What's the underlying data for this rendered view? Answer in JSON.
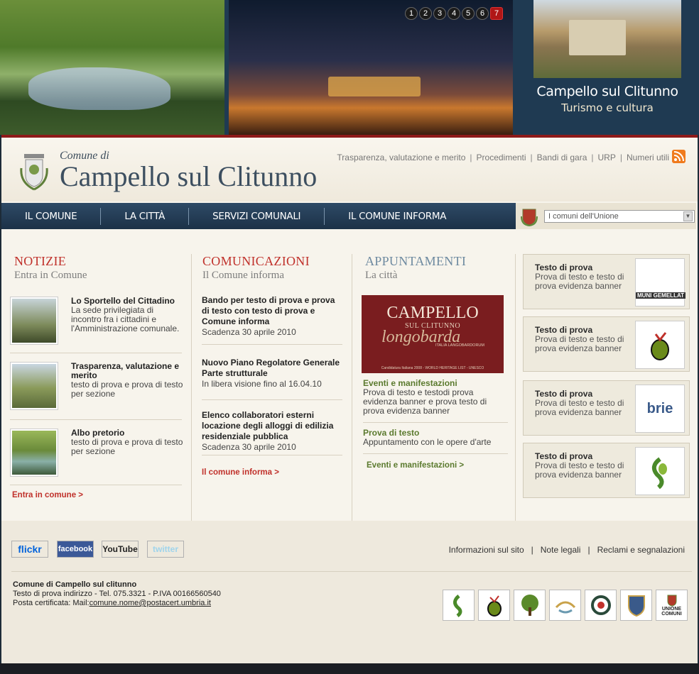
{
  "banner": {
    "slider_numbers": [
      "1",
      "2",
      "3",
      "4",
      "5",
      "6",
      "7"
    ],
    "active_slide": "7",
    "town_title": "Campello sul Clitunno",
    "town_subtitle": "Turismo e cultura"
  },
  "header": {
    "comune_di": "Comune di",
    "site_title": "Campello sul Clitunno",
    "top_links": [
      "Trasparenza, valutazione e merito",
      "Procedimenti",
      "Bandi di gara",
      "URP",
      "Numeri utili"
    ]
  },
  "nav": {
    "items": [
      "IL COMUNE",
      "LA CITTÀ",
      "SERVIZI COMUNALI",
      "IL COMUNE INFORMA"
    ],
    "union_select_value": "I comuni dell'Unione"
  },
  "notizie": {
    "title": "NOTIZIE",
    "subtitle": "Entra in Comune",
    "items": [
      {
        "title": "Lo Sportello del Cittadino",
        "text": "La  sede privilegiata di incontro fra i cittadini e l'Amministrazione comunale."
      },
      {
        "title": "Trasparenza, valutazione e merito",
        "text": "testo di prova e prova di testo per sezione"
      },
      {
        "title": "Albo pretorio",
        "text": "testo di prova e prova di testo per sezione"
      }
    ],
    "more": "Entra in comune >"
  },
  "comunicazioni": {
    "title": "COMUNICAZIONI",
    "subtitle": "Il Comune informa",
    "items": [
      {
        "title": "Bando per testo di prova e prova di testo con testo di prova e Comune informa",
        "text": "Scadenza 30 aprile 2010"
      },
      {
        "title": "Nuovo Piano Regolatore Generale Parte strutturale",
        "text": "In libera visione fino al 16.04.10"
      },
      {
        "title": "Elenco collaboratori esterni locazione degli alloggi di edilizia residenziale pubblica",
        "text": "Scadenza 30 aprile 2010"
      }
    ],
    "more": "Il comune informa >"
  },
  "appuntamenti": {
    "title": "APPUNTAMENTI",
    "subtitle": "La città",
    "poster": {
      "main": "CAMPELLO",
      "sub": "SUL CLITUNNO",
      "italic": "longobarda",
      "small": "ITALIA LANGOBARDORUM",
      "footer": "Candidatura Italiana 2008 - WORLD HERITAGE LIST - UNESCO"
    },
    "items": [
      {
        "title": "Eventi e manifestazioni",
        "text": "Prova di testo e testodi prova evidenza banner  e prova  testo di prova evidenza banner"
      },
      {
        "title": "Prova di testo",
        "text": "Appuntamento con le opere d'arte"
      }
    ],
    "more": "Eventi e manifestazioni >"
  },
  "sidebar_banners": [
    {
      "title": "Testo di prova",
      "text": "Prova di testo e testo di prova evidenza banner",
      "logo_text": "MUNI GEMELLAT"
    },
    {
      "title": "Testo di prova",
      "text": "Prova di testo e testo di prova evidenza banner",
      "logo_text": ""
    },
    {
      "title": "Testo di prova",
      "text": "Prova di testo e testo di prova evidenza banner",
      "logo_text": "brie"
    },
    {
      "title": "Testo di prova",
      "text": "Prova di testo e testo di prova evidenza banner",
      "logo_text": ""
    }
  ],
  "footer": {
    "social": [
      "flickr",
      "facebook",
      "YouTube",
      "twitter"
    ],
    "links": [
      "Informazioni sul sito",
      "Note legali",
      "Reclami e segnalazioni"
    ],
    "address_title": "Comune di Campello sul clitunno",
    "address_line1": "Testo di prova indirizzo  - Tel. 075.3321 - P.IVA 00166560540",
    "address_pec_label": "Posta certificata: Mail:",
    "address_pec_mail": "comune.nome@postacert.umbria.it",
    "partner_last_label": "UNIONE COMUNI"
  }
}
